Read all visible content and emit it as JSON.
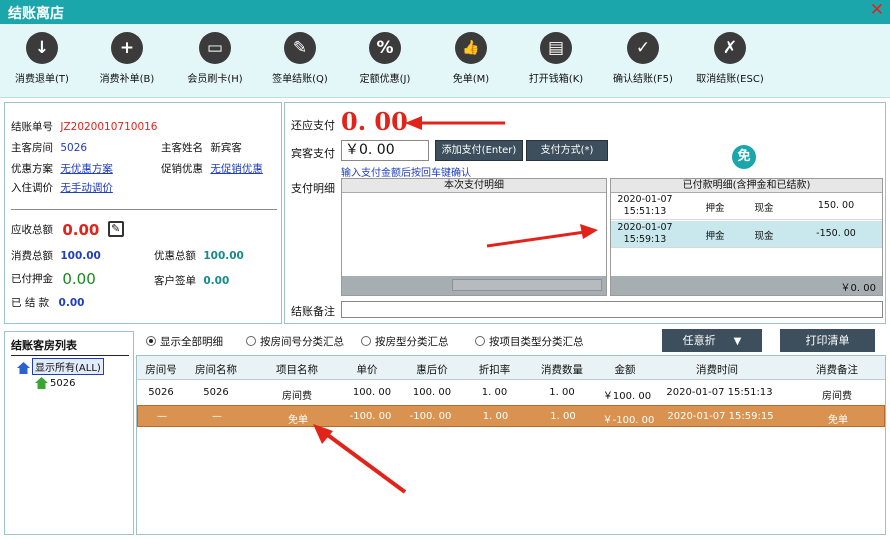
{
  "window": {
    "title": "结账离店",
    "close": "✕"
  },
  "toolbar": [
    {
      "label": "消费退单(T)",
      "icon": "download-icon",
      "glyph": "↓"
    },
    {
      "label": "消费补单(B)",
      "icon": "plus-circle-icon",
      "glyph": "+"
    },
    {
      "label": "会员刷卡(H)",
      "icon": "card-icon",
      "glyph": "▭"
    },
    {
      "label": "签单结账(Q)",
      "icon": "sign-icon",
      "glyph": "✎"
    },
    {
      "label": "定额优惠(J)",
      "icon": "percent-icon",
      "glyph": "%"
    },
    {
      "label": "免单(M)",
      "icon": "thumbs-up-icon",
      "glyph": "👍"
    },
    {
      "label": "打开钱箱(K)",
      "icon": "wallet-icon",
      "glyph": "▤"
    },
    {
      "label": "确认结账(F5)",
      "icon": "check-icon",
      "glyph": "✓"
    },
    {
      "label": "取消结账(ESC)",
      "icon": "cancel-icon",
      "glyph": "✗"
    }
  ],
  "info": {
    "bill_no_label": "结账单号",
    "bill_no": "JZ2020010710016",
    "room_label": "主客房间",
    "room": "5026",
    "guest_label": "主客姓名",
    "guest": "新宾客",
    "discount_plan_label": "优惠方案",
    "discount_plan": "无优惠方案",
    "promo_label": "促销优惠",
    "promo": "无促销优惠",
    "price_adjust_label": "入住调价",
    "price_adjust": "无手动调价",
    "receivable_label": "应收总额",
    "receivable": "0.00",
    "consume_total_label": "消费总额",
    "consume_total": "100.00",
    "discount_total_label": "优惠总额",
    "discount_total": "100.00",
    "deposit_paid_label": "已付押金",
    "deposit_paid": "0.00",
    "guest_sign_label": "客户签单",
    "guest_sign": "0.00",
    "settled_label": "已 结 款",
    "settled": "0.00"
  },
  "payment": {
    "due_label": "还应支付",
    "due": "0. 00",
    "guest_pay_label": "宾客支付",
    "guest_pay": "￥0. 00",
    "add_pay_button": "添加支付(Enter)",
    "pay_method_button": "支付方式(*)",
    "hint": "输入支付金额后按回车键确认",
    "free_badge": "免",
    "detail_label": "支付明细",
    "current_header": "本次支付明细",
    "paid_header": "已付款明细(含押金和已结款)",
    "paid_rows": [
      {
        "time": "2020-01-07 15:51:13",
        "type": "押金",
        "method": "现金",
        "amount": "150. 00"
      },
      {
        "time": "2020-01-07 15:59:13",
        "type": "押金",
        "method": "现金",
        "amount": "-150. 00"
      }
    ],
    "paid_total": "￥0. 00",
    "remark_label": "结账备注"
  },
  "tree": {
    "title": "结账客房列表",
    "all": "显示所有(ALL)",
    "room": "5026"
  },
  "filters": {
    "options": [
      "显示全部明细",
      "按房间号分类汇总",
      "按房型分类汇总",
      "按项目类型分类汇总"
    ],
    "selected": "显示全部明细",
    "discount_button": "任意折",
    "print_button": "打印清单"
  },
  "table": {
    "columns": [
      "房间号",
      "房间名称",
      "项目名称",
      "单价",
      "惠后价",
      "折扣率",
      "消费数量",
      "金额",
      "消费时间",
      "消费备注"
    ],
    "rows": [
      [
        "5026",
        "5026",
        "房间费",
        "100. 00",
        "100. 00",
        "1. 00",
        "1. 00",
        "￥100. 00",
        "2020-01-07 15:51:13",
        "房间费"
      ],
      [
        "—",
        "—",
        "免单",
        "-100. 00",
        "-100. 00",
        "1. 00",
        "1. 00",
        "￥-100. 00",
        "2020-01-07 15:59:15",
        "免单"
      ]
    ]
  },
  "colors": {
    "accent": "#1ba6ac",
    "alert": "#e2231a",
    "selected_row": "#d9924f",
    "button": "#3d4f5c"
  }
}
